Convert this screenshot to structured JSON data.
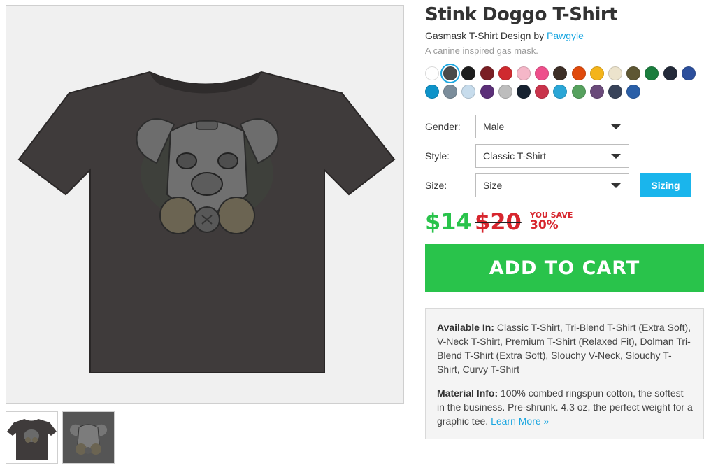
{
  "product": {
    "title": "Stink Doggo T-Shirt",
    "design_type": "Gasmask T-Shirt Design by",
    "artist": "Pawgyle",
    "tagline": "A canine inspired gas mask.",
    "image_alt": "dark t-shirt with dog gas mask print",
    "main_image": "black-tshirt-dog-gasmask-mockup",
    "thumbnails": [
      "black-tshirt-thumb",
      "gasmask-art-thumb"
    ]
  },
  "colors": {
    "selected_index": 1,
    "swatches": [
      "#ffffff",
      "#4a4a4a",
      "#1e1e1e",
      "#7a1e24",
      "#cf2a2f",
      "#f5b7c8",
      "#ee4f8b",
      "#3e2f27",
      "#e04a0c",
      "#f4b41a",
      "#ece3cc",
      "#5e5733",
      "#1a7d3d",
      "#232a39",
      "#2c4f9c",
      "#0e93c9",
      "#7b8d9b",
      "#c7dcec",
      "#5b2f78",
      "#bdbdbd",
      "#172230",
      "#c9334b",
      "#2aa6d6",
      "#56a15e",
      "#6a4a7a",
      "#384359",
      "#2a5fa8"
    ],
    "accent": "#1ab5ec",
    "price_green": "#29c34b",
    "sale_red": "#d7262e"
  },
  "options": {
    "gender_label": "Gender:",
    "gender_value": "Male",
    "style_label": "Style:",
    "style_value": "Classic T-Shirt",
    "size_label": "Size:",
    "size_value": "Size",
    "sizing_button": "Sizing"
  },
  "pricing": {
    "price": "$14",
    "old_price": "$20",
    "save_label": "YOU SAVE",
    "save_percent": "30%"
  },
  "cart": {
    "label": "ADD TO CART"
  },
  "info": {
    "available_heading": "Available In:",
    "available_text": " Classic T-Shirt, Tri-Blend T-Shirt (Extra Soft), V-Neck T-Shirt, Premium T-Shirt (Relaxed Fit), Dolman Tri-Blend T-Shirt (Extra Soft), Slouchy V-Neck, Slouchy T-Shirt, Curvy T-Shirt",
    "material_heading": "Material Info:",
    "material_text": " 100% combed ringspun cotton, the softest in the business. Pre-shrunk. 4.3 oz, the perfect weight for a graphic tee. ",
    "learn_more": "Learn More »"
  }
}
